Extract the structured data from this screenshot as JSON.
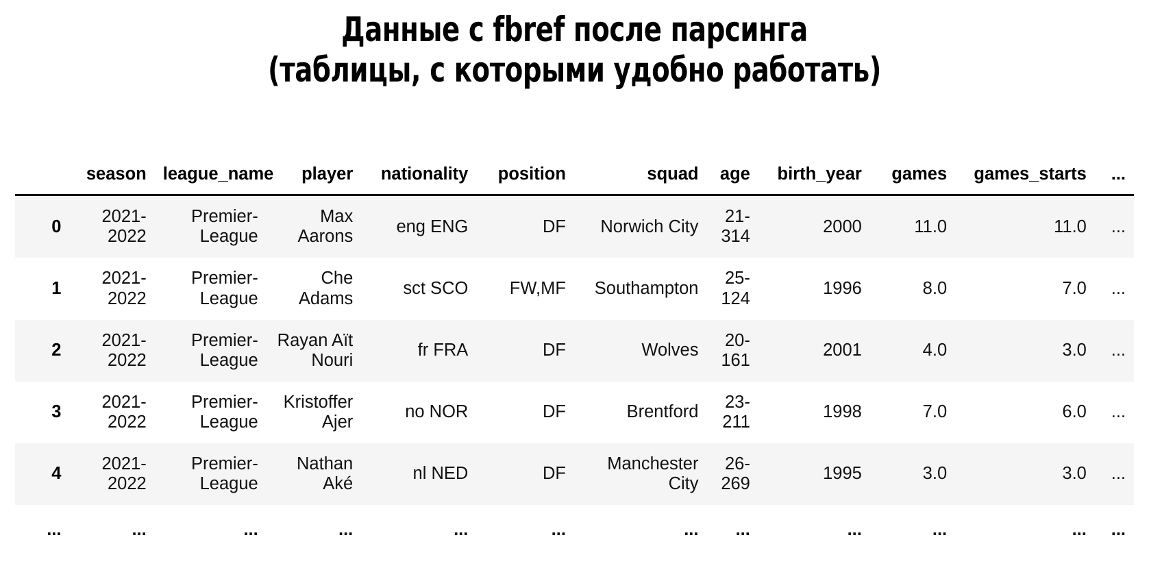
{
  "title": {
    "line1": "Данные с fbref после парсинга",
    "line2": "(таблицы, с которыми удобно работать)"
  },
  "table": {
    "index_header": "",
    "columns": [
      "season",
      "league_name",
      "player",
      "nationality",
      "position",
      "squad",
      "age",
      "birth_year",
      "games",
      "games_starts",
      "..."
    ],
    "rows": [
      {
        "index": "0",
        "season": "2021-2022",
        "league_name": "Premier-League",
        "player": "Max Aarons",
        "nationality": "eng ENG",
        "position": "DF",
        "squad": "Norwich City",
        "age": "21-314",
        "birth_year": "2000",
        "games": "11.0",
        "games_starts": "11.0",
        "more": "..."
      },
      {
        "index": "1",
        "season": "2021-2022",
        "league_name": "Premier-League",
        "player": "Che Adams",
        "nationality": "sct SCO",
        "position": "FW,MF",
        "squad": "Southampton",
        "age": "25-124",
        "birth_year": "1996",
        "games": "8.0",
        "games_starts": "7.0",
        "more": "..."
      },
      {
        "index": "2",
        "season": "2021-2022",
        "league_name": "Premier-League",
        "player": "Rayan Aït Nouri",
        "nationality": "fr FRA",
        "position": "DF",
        "squad": "Wolves",
        "age": "20-161",
        "birth_year": "2001",
        "games": "4.0",
        "games_starts": "3.0",
        "more": "..."
      },
      {
        "index": "3",
        "season": "2021-2022",
        "league_name": "Premier-League",
        "player": "Kristoffer Ajer",
        "nationality": "no NOR",
        "position": "DF",
        "squad": "Brentford",
        "age": "23-211",
        "birth_year": "1998",
        "games": "7.0",
        "games_starts": "6.0",
        "more": "..."
      },
      {
        "index": "4",
        "season": "2021-2022",
        "league_name": "Premier-League",
        "player": "Nathan Aké",
        "nationality": "nl NED",
        "position": "DF",
        "squad": "Manchester City",
        "age": "26-269",
        "birth_year": "1995",
        "games": "3.0",
        "games_starts": "3.0",
        "more": "..."
      }
    ],
    "ellipsis_row": {
      "index": "...",
      "season": "...",
      "league_name": "...",
      "player": "...",
      "nationality": "...",
      "position": "...",
      "squad": "...",
      "age": "...",
      "birth_year": "...",
      "games": "...",
      "games_starts": "...",
      "more": "..."
    }
  }
}
